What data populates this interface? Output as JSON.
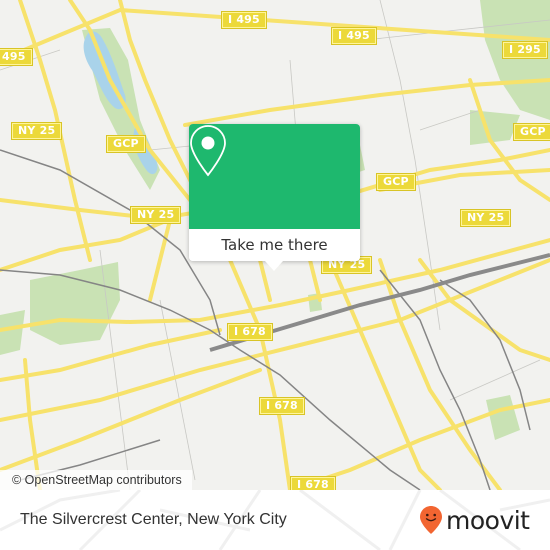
{
  "map": {
    "road_labels": [
      {
        "id": "i495-top-left",
        "text": "I 495"
      },
      {
        "id": "i495-left-edge",
        "text": "495"
      },
      {
        "id": "i495-top-right",
        "text": "I 495"
      },
      {
        "id": "i295",
        "text": "I 295"
      },
      {
        "id": "ny25-left",
        "text": "NY 25"
      },
      {
        "id": "gcp-left",
        "text": "GCP"
      },
      {
        "id": "gcp-middle",
        "text": "GCP"
      },
      {
        "id": "gcp-right",
        "text": "GCP"
      },
      {
        "id": "ny25-center-left",
        "text": "NY 25"
      },
      {
        "id": "ny25-right",
        "text": "NY 25"
      },
      {
        "id": "ny25-center",
        "text": "NY 25"
      },
      {
        "id": "i678-upper",
        "text": "I 678"
      },
      {
        "id": "i678-middle",
        "text": "I 678"
      },
      {
        "id": "i678-lower",
        "text": "I 678"
      }
    ],
    "attribution": "© OpenStreetMap contributors",
    "colors": {
      "land": "#f2f2ef",
      "road": "#f7e26b",
      "water": "#a9d3ea",
      "park": "#c9e2b4",
      "rail": "#858585"
    }
  },
  "popup": {
    "icon": "map-pin-icon",
    "button_label": "Take me there",
    "accent_color": "#1eb86e"
  },
  "footer": {
    "title": "The Silvercrest Center, New York City",
    "brand": "moovit",
    "brand_color": "#f26531"
  }
}
